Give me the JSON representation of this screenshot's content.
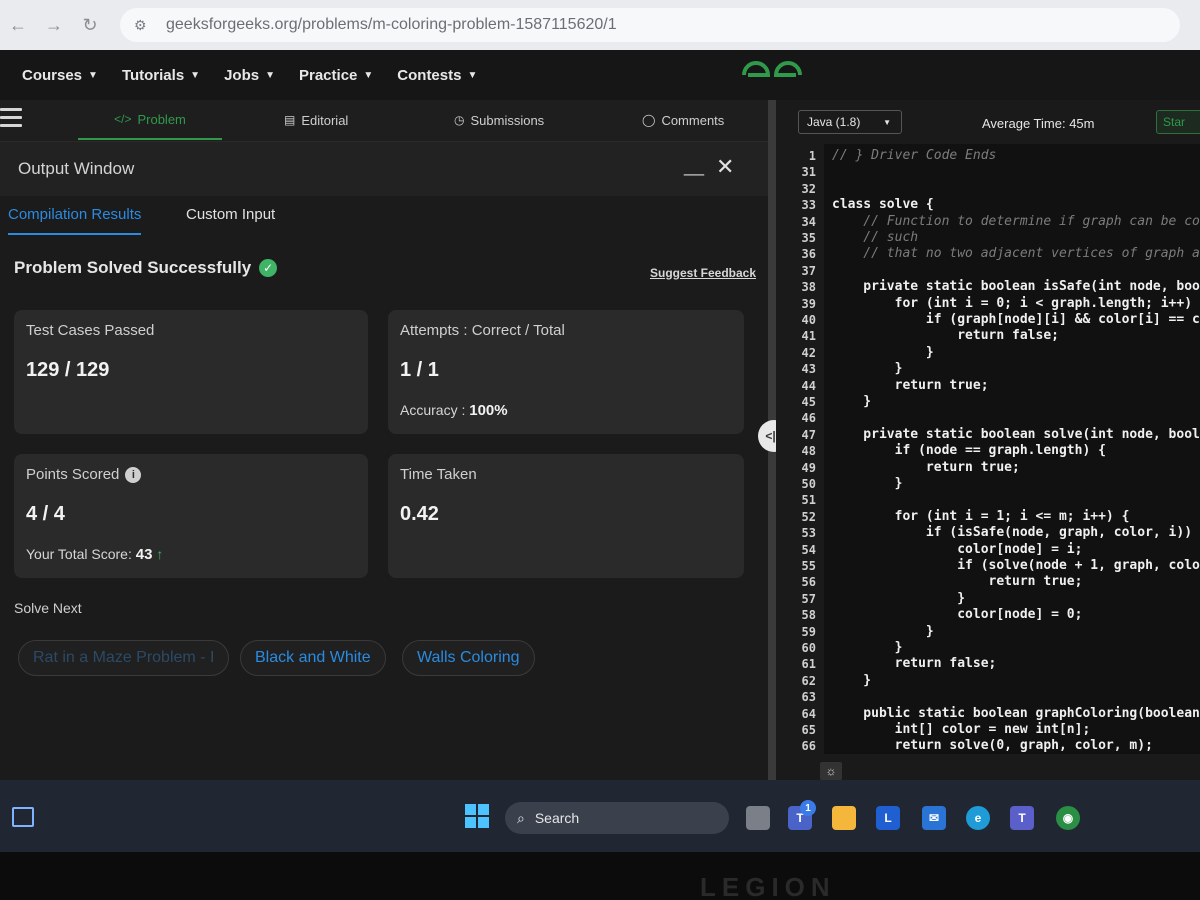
{
  "browser": {
    "url": "geeksforgeeks.org/problems/m-coloring-problem-1587115620/1"
  },
  "gfg_nav": {
    "items": [
      "Courses",
      "Tutorials",
      "Jobs",
      "Practice",
      "Contests"
    ]
  },
  "problem_tabs": {
    "problem": "Problem",
    "editorial": "Editorial",
    "submissions": "Submissions",
    "comments": "Comments"
  },
  "output": {
    "title": "Output Window",
    "tab_compilation": "Compilation Results",
    "tab_custom": "Custom Input",
    "status": "Problem Solved Successfully",
    "feedback": "Suggest Feedback",
    "cards": {
      "test_cases_label": "Test Cases Passed",
      "test_cases_value": "129 / 129",
      "attempts_label": "Attempts : Correct / Total",
      "attempts_value": "1 / 1",
      "accuracy_label": "Accuracy :",
      "accuracy_value": "100%",
      "points_label": "Points Scored",
      "points_value": "4 / 4",
      "total_score_label": "Your Total Score:",
      "total_score_value": "43",
      "time_label": "Time Taken",
      "time_value": "0.42"
    },
    "solve_next_label": "Solve Next",
    "solve_next": [
      "Rat in a Maze Problem - I",
      "Black and White",
      "Walls Coloring"
    ]
  },
  "editor": {
    "language": "Java (1.8)",
    "avg_time": "Average Time: 45m",
    "start_btn": "Star",
    "lines": [
      {
        "n": "1",
        "code": "// } Driver Code Ends",
        "type": "cm"
      },
      {
        "n": "31",
        "code": "",
        "type": "code"
      },
      {
        "n": "32",
        "code": "",
        "type": "code"
      },
      {
        "n": "33",
        "code": "class solve {",
        "type": "code"
      },
      {
        "n": "34",
        "code": "    // Function to determine if graph can be co",
        "type": "cm"
      },
      {
        "n": "35",
        "code": "    // such",
        "type": "cm"
      },
      {
        "n": "36",
        "code": "    // that no two adjacent vertices of graph a",
        "type": "cm"
      },
      {
        "n": "37",
        "code": "",
        "type": "code"
      },
      {
        "n": "38",
        "code": "    private static boolean isSafe(int node, boo",
        "type": "code"
      },
      {
        "n": "39",
        "code": "        for (int i = 0; i < graph.length; i++)",
        "type": "code"
      },
      {
        "n": "40",
        "code": "            if (graph[node][i] && color[i] == c",
        "type": "code"
      },
      {
        "n": "41",
        "code": "                return false;",
        "type": "code"
      },
      {
        "n": "42",
        "code": "            }",
        "type": "code"
      },
      {
        "n": "43",
        "code": "        }",
        "type": "code"
      },
      {
        "n": "44",
        "code": "        return true;",
        "type": "code"
      },
      {
        "n": "45",
        "code": "    }",
        "type": "code"
      },
      {
        "n": "46",
        "code": "",
        "type": "code"
      },
      {
        "n": "47",
        "code": "    private static boolean solve(int node, bool",
        "type": "code"
      },
      {
        "n": "48",
        "code": "        if (node == graph.length) {",
        "type": "code"
      },
      {
        "n": "49",
        "code": "            return true;",
        "type": "code"
      },
      {
        "n": "50",
        "code": "        }",
        "type": "code"
      },
      {
        "n": "51",
        "code": "",
        "type": "code"
      },
      {
        "n": "52",
        "code": "        for (int i = 1; i <= m; i++) {",
        "type": "code"
      },
      {
        "n": "53",
        "code": "            if (isSafe(node, graph, color, i))",
        "type": "code"
      },
      {
        "n": "54",
        "code": "                color[node] = i;",
        "type": "code"
      },
      {
        "n": "55",
        "code": "                if (solve(node + 1, graph, colo",
        "type": "code"
      },
      {
        "n": "56",
        "code": "                    return true;",
        "type": "code"
      },
      {
        "n": "57",
        "code": "                }",
        "type": "code"
      },
      {
        "n": "58",
        "code": "                color[node] = 0;",
        "type": "code"
      },
      {
        "n": "59",
        "code": "            }",
        "type": "code"
      },
      {
        "n": "60",
        "code": "        }",
        "type": "code"
      },
      {
        "n": "61",
        "code": "        return false;",
        "type": "code"
      },
      {
        "n": "62",
        "code": "    }",
        "type": "code"
      },
      {
        "n": "63",
        "code": "",
        "type": "code"
      },
      {
        "n": "64",
        "code": "    public static boolean graphColoring(boolean",
        "type": "code"
      },
      {
        "n": "65",
        "code": "        int[] color = new int[n];",
        "type": "code"
      },
      {
        "n": "66",
        "code": "        return solve(0, graph, color, m);",
        "type": "code"
      }
    ]
  },
  "taskbar": {
    "search_label": "Search",
    "notification_badge": "1",
    "apps": [
      "File Explorer",
      "L",
      "Mail",
      "Edge",
      "Teams",
      "Chrome"
    ]
  },
  "bezel": {
    "brand": "LEGION"
  },
  "colors": {
    "gfg_green": "#2f9a4a",
    "link_blue": "#2a8be0"
  }
}
